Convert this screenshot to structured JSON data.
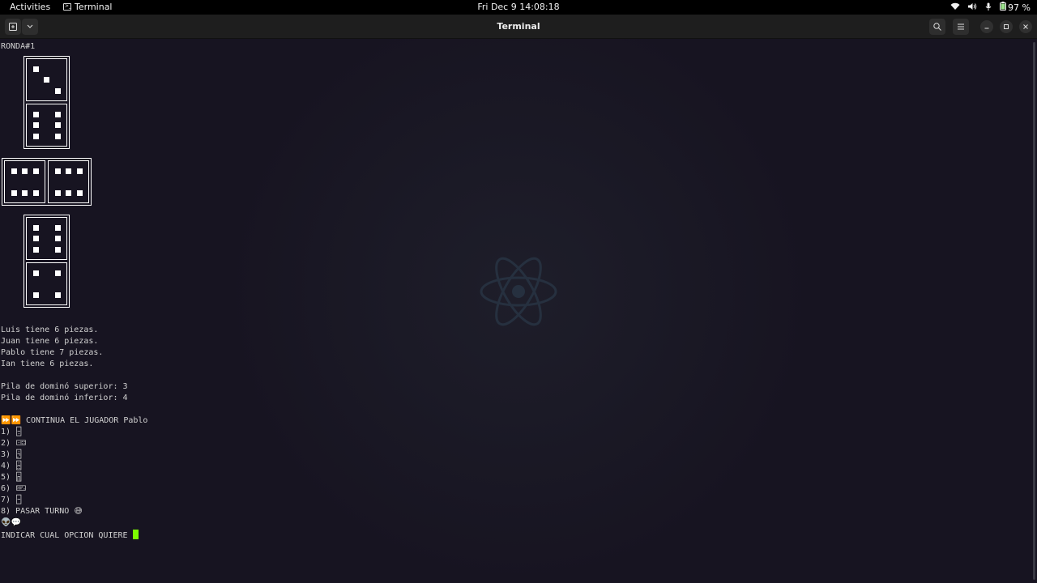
{
  "topbar": {
    "activities": "Activities",
    "app_name": "Terminal",
    "clock": "Fri Dec 9  14:08:18",
    "battery": "97 %"
  },
  "window": {
    "title": "Terminal"
  },
  "terminal": {
    "round_label": "RONDA#1",
    "players": [
      "Luis tiene 6 piezas.",
      "Juan tiene 6 piezas.",
      "Pablo tiene 7 piezas.",
      "Ian tiene 6 piezas."
    ],
    "pile_top": "Pila de dominó superior: 3",
    "pile_bottom": "Pila de dominó inferior: 4",
    "continue_icons": "⏩⏩",
    "continue_text": "CONTINUA EL JUGADOR Pablo",
    "options": [
      {
        "num": "1)",
        "glyph": "🁤"
      },
      {
        "num": "2)",
        "glyph": "🀼"
      },
      {
        "num": "3)",
        "glyph": "🁬"
      },
      {
        "num": "4)",
        "glyph": "🁮"
      },
      {
        "num": "5)",
        "glyph": "🁰"
      },
      {
        "num": "6)",
        "glyph": "🁖"
      },
      {
        "num": "7)",
        "glyph": "🁣"
      }
    ],
    "pass_option": "8) PASAR TURNO",
    "pass_emoji": "😅",
    "alien_line": "👽💬",
    "prompt": "INDICAR CUAL OPCION QUIERE"
  },
  "board": {
    "dominoes": [
      {
        "orientation": "vertical",
        "pips": [
          3,
          6
        ]
      },
      {
        "orientation": "horizontal",
        "pips": [
          6,
          6
        ]
      },
      {
        "orientation": "vertical",
        "pips": [
          6,
          4
        ]
      }
    ]
  },
  "colors": {
    "background": "#171421",
    "cursor": "#7cfc00",
    "logo": "#26303f"
  },
  "icons": [
    "terminal-icon",
    "wifi-icon",
    "volume-icon",
    "mic-icon",
    "battery-icon",
    "new-tab-icon",
    "search-icon",
    "menu-icon",
    "minimize-icon",
    "maximize-icon",
    "close-icon",
    "react-logo-icon"
  ]
}
